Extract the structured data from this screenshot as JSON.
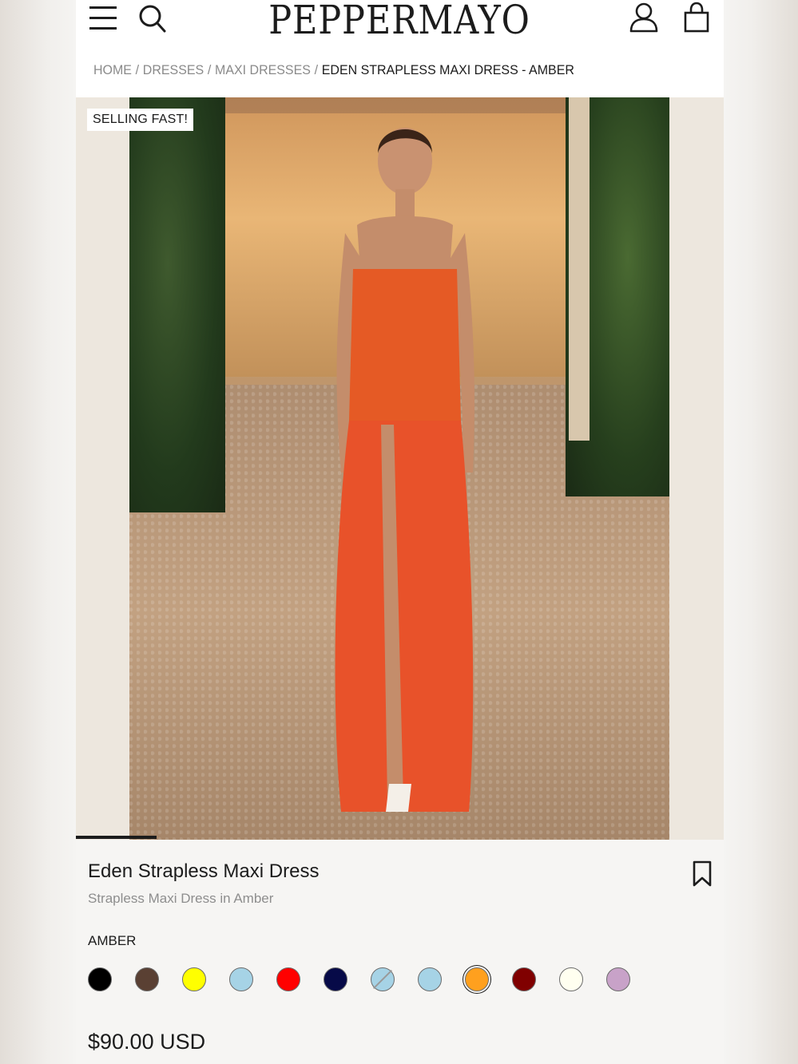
{
  "header": {
    "logo": "PEPPERMAYO",
    "icons": [
      "menu-icon",
      "search-icon",
      "account-icon",
      "bag-icon"
    ]
  },
  "breadcrumb": {
    "items": [
      "HOME",
      "DRESSES",
      "MAXI DRESSES"
    ],
    "current": "EDEN STRAPLESS MAXI DRESS - AMBER",
    "separator": "/"
  },
  "gallery": {
    "badge": "SELLING FAST!",
    "progress_fraction": 0.125
  },
  "product": {
    "title": "Eden Strapless Maxi Dress",
    "subtitle": "Strapless Maxi Dress in Amber",
    "selected_color": "AMBER",
    "price": "$90.00 USD",
    "bookmark_icon": "bookmark-icon"
  },
  "swatches": [
    {
      "color": "#000000",
      "slashed": false,
      "selected": false
    },
    {
      "color": "#5a4033",
      "slashed": false,
      "selected": false
    },
    {
      "color": "#ffff00",
      "slashed": false,
      "selected": false
    },
    {
      "color": "#a6d3e6",
      "slashed": false,
      "selected": false
    },
    {
      "color": "#ff0000",
      "slashed": false,
      "selected": false
    },
    {
      "color": "#070a48",
      "slashed": false,
      "selected": false
    },
    {
      "color": "#a6d3e6",
      "slashed": true,
      "selected": false
    },
    {
      "color": "#a6d3e6",
      "slashed": false,
      "selected": false
    },
    {
      "color": "#ffa01e",
      "slashed": false,
      "selected": true
    },
    {
      "color": "#800000",
      "slashed": false,
      "selected": false
    },
    {
      "color": "#fffff0",
      "slashed": false,
      "selected": false
    },
    {
      "color": "#c8a2c8",
      "slashed": false,
      "selected": false
    }
  ]
}
